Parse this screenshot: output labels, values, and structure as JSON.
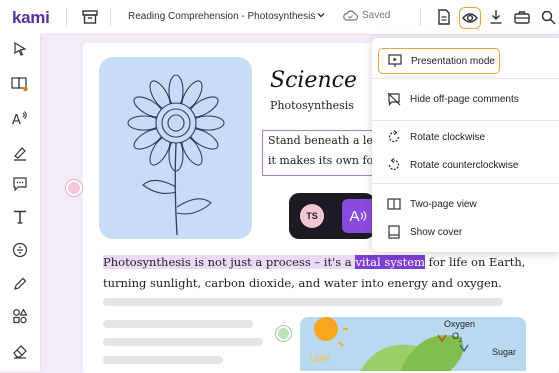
{
  "app": {
    "logo": "kami"
  },
  "toolbar": {
    "doc_title": "Reading Comprehension - Photosynthesis",
    "saved_label": "Saved",
    "icons": [
      "file-icon",
      "eye-icon",
      "download-icon",
      "briefcase-icon",
      "search-icon"
    ]
  },
  "sidebar": {
    "tools": [
      "select-tool-icon",
      "dictionary-tool-icon",
      "text-to-speech-icon",
      "highlighter-icon",
      "comment-icon",
      "text-icon",
      "equation-icon",
      "pen-icon",
      "shapes-icon",
      "eraser-icon"
    ]
  },
  "document": {
    "heading": "Science",
    "subheading": "Photosynthesis",
    "textbox_lines": [
      "Stand beneath a le",
      "it makes its own fo"
    ],
    "paragraph": {
      "line1_before": "Photosynthesis is not just a process – it's a ",
      "line1_highlight": "vital system",
      "line1_after": " for life on Earth,",
      "line2": "turning sunlight, carbon dioxide, and water into energy and oxygen."
    },
    "illustration_labels": {
      "oxygen": "Oxygen",
      "o2": "O",
      "sugar": "Sugar",
      "light": "Light"
    }
  },
  "floating_toolbar": {
    "avatar_initials": "TS",
    "tts_label": "A"
  },
  "view_menu": {
    "items": [
      {
        "label": "Presentation mode",
        "icon": "presentation-icon"
      },
      {
        "label": "Hide off-page comments",
        "icon": "comment-off-icon"
      },
      {
        "label": "Rotate clockwise",
        "icon": "rotate-cw-icon"
      },
      {
        "label": "Rotate counterclockwise",
        "icon": "rotate-ccw-icon"
      },
      {
        "label": "Two-page view",
        "icon": "two-page-icon"
      },
      {
        "label": "Show cover",
        "icon": "cover-icon"
      }
    ]
  },
  "colors": {
    "brand": "#5a2ea6",
    "accent": "#f0a23c",
    "highlight": "#7d3fd6"
  }
}
